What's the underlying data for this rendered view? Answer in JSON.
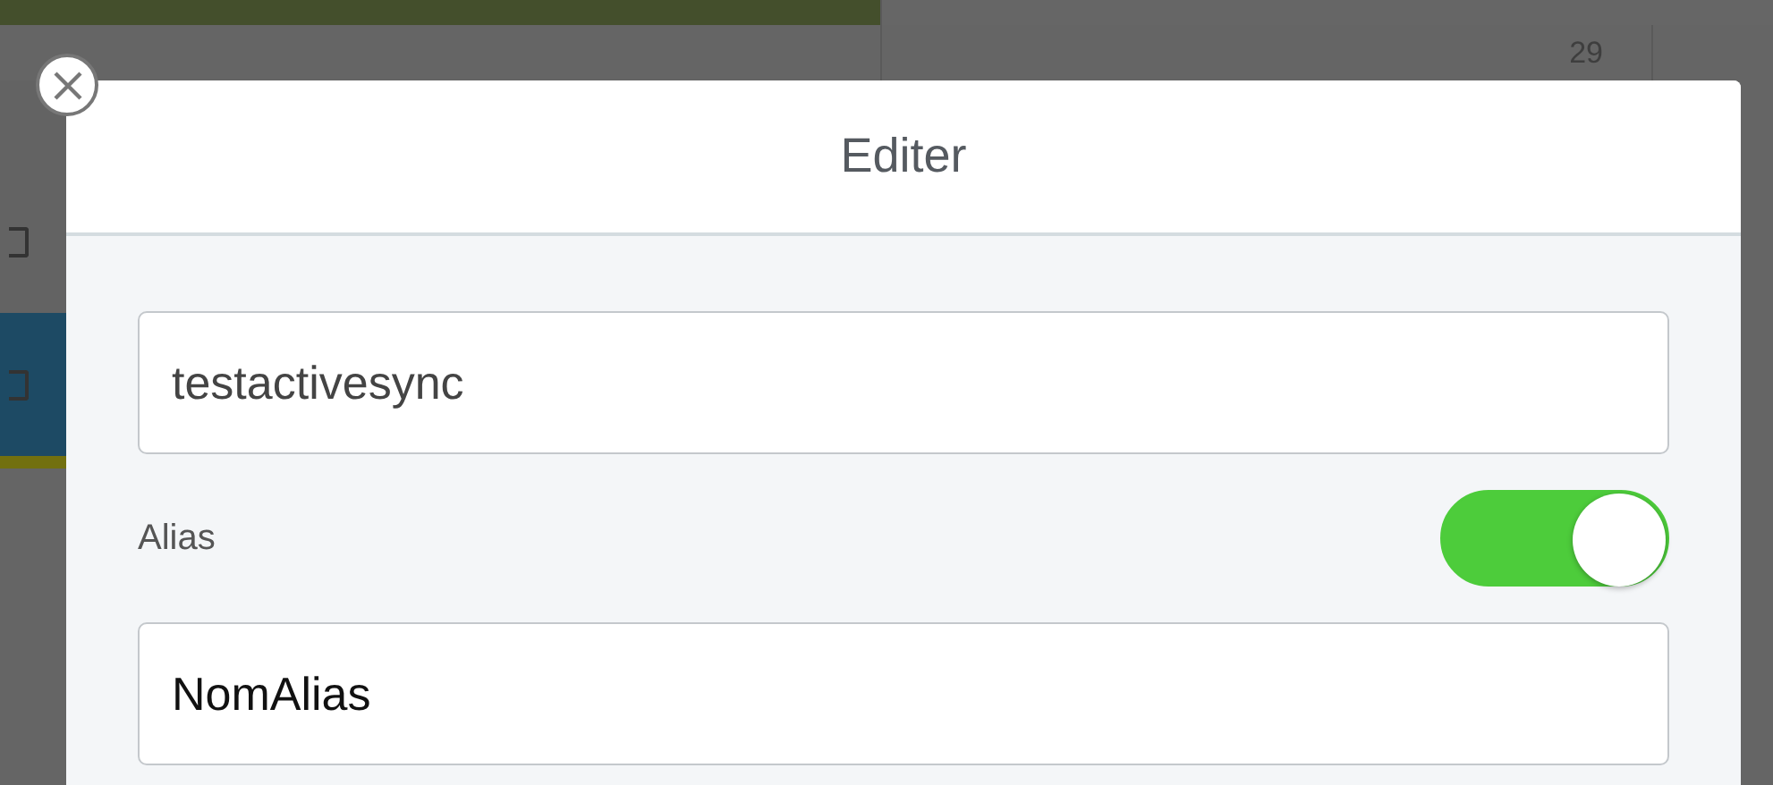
{
  "background": {
    "cell_text": "29",
    "checkboxes": [
      {
        "checked": false
      },
      {
        "checked": false
      }
    ]
  },
  "dialog": {
    "title": "Editer",
    "name_field": {
      "value": "testactivesync"
    },
    "alias_toggle": {
      "label": "Alias",
      "on": true
    },
    "alias_field": {
      "value": "NomAlias"
    }
  }
}
